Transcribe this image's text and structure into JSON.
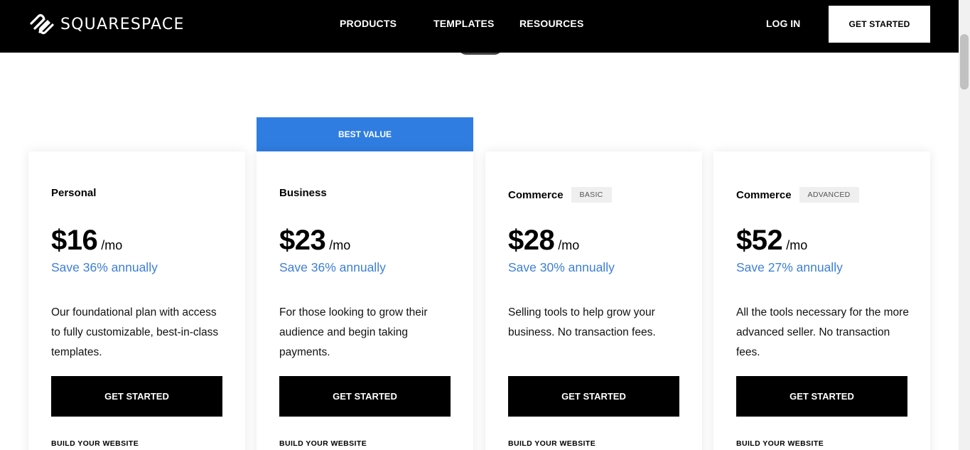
{
  "header": {
    "logo_text": "SQUARESPACE",
    "nav": [
      {
        "label": "PRODUCTS",
        "has_dropdown": true
      },
      {
        "label": "TEMPLATES",
        "has_dropdown": false
      },
      {
        "label": "RESOURCES",
        "has_dropdown": true
      }
    ],
    "login_label": "LOG IN",
    "cta_label": "GET STARTED"
  },
  "colors": {
    "accent_blue": "#2f7de1",
    "save_text": "#3d7fd6",
    "header_bg": "#000000"
  },
  "banner_label": "BEST VALUE",
  "plans": [
    {
      "name": "Personal",
      "badge": "",
      "price": "$16",
      "period": "/mo",
      "save": "Save 36% annually",
      "description": "Our foundational plan with access to fully customizable, best-in-class templates.",
      "button_label": "GET STARTED",
      "section_label": "BUILD YOUR WEBSITE"
    },
    {
      "name": "Business",
      "badge": "",
      "price": "$23",
      "period": "/mo",
      "save": "Save 36% annually",
      "description": "For those looking to grow their audience and begin taking payments.",
      "button_label": "GET STARTED",
      "section_label": "BUILD YOUR WEBSITE"
    },
    {
      "name": "Commerce",
      "badge": "BASIC",
      "price": "$28",
      "period": "/mo",
      "save": "Save 30% annually",
      "description": "Selling tools to help grow your business. No transaction fees.",
      "button_label": "GET STARTED",
      "section_label": "BUILD YOUR WEBSITE"
    },
    {
      "name": "Commerce",
      "badge": "ADVANCED",
      "price": "$52",
      "period": "/mo",
      "save": "Save 27% annually",
      "description": "All the tools necessary for the more advanced seller. No transaction fees.",
      "button_label": "GET STARTED",
      "section_label": "BUILD YOUR WEBSITE"
    }
  ]
}
